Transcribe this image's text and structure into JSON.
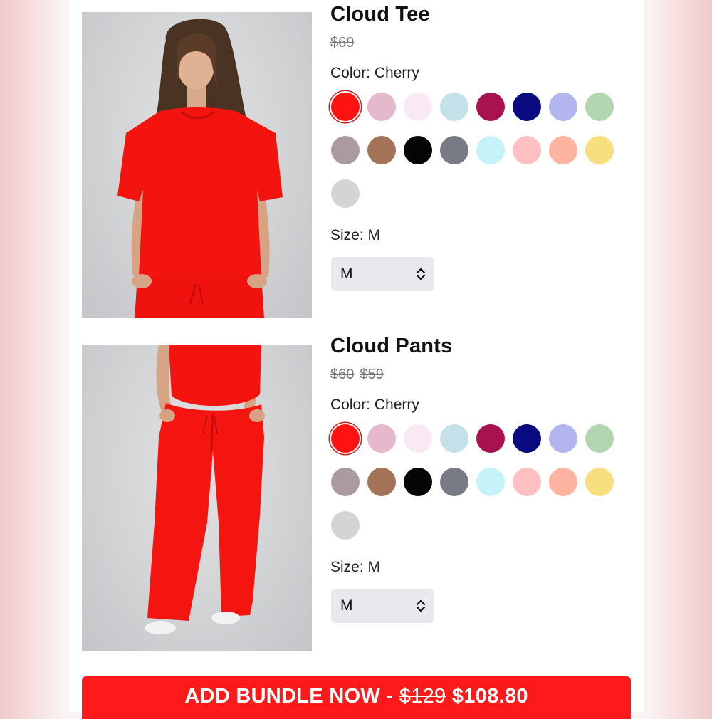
{
  "products": [
    {
      "title": "Cloud Tee",
      "price_original": "$69",
      "price_sale": "",
      "color_label": "Color: Cherry",
      "size_label": "Size: M",
      "size_value": "M",
      "photo_icon": "model-wearing-tee-photo"
    },
    {
      "title": "Cloud Pants",
      "price_original": "$60",
      "price_sale": "$59",
      "color_label": "Color: Cherry",
      "size_label": "Size: M",
      "size_value": "M",
      "photo_icon": "model-wearing-pants-photo"
    }
  ],
  "swatch_colors": [
    "#fe1212",
    "#e6b8cc",
    "#f8e9f5",
    "#c4e0e8",
    "#a8134f",
    "#0a0a80",
    "#b3b6ee",
    "#b3d5b1",
    "#ab9ba0",
    "#a37358",
    "#050505",
    "#787b86",
    "#c6f2fa",
    "#ffbfc3",
    "#ffb3a1",
    "#f8df7d",
    "#d4d4d4"
  ],
  "selected_swatch_index": 0,
  "bundle": {
    "prefix": "ADD BUNDLE NOW - ",
    "old_price": "$129",
    "new_price": "$108.80"
  },
  "icons": {
    "select_chevron": "chevron-up-down-icon"
  },
  "accent_color": "#fe1a1a"
}
